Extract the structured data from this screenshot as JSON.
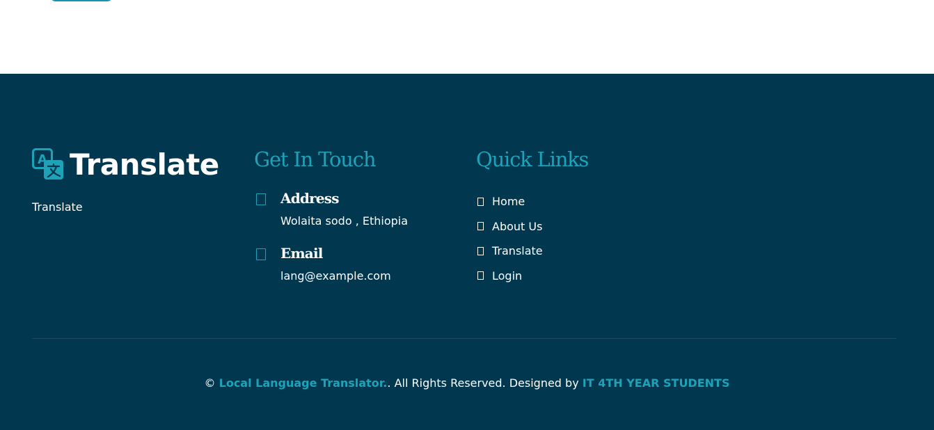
{
  "colors": {
    "footer_background": "#01374f",
    "accent": "#1ea2b8",
    "text": "#ffffff"
  },
  "brand": {
    "name": "Translate",
    "description": "Translate",
    "icon": "translate-icon"
  },
  "contact": {
    "heading": "Get In Touch",
    "address": {
      "icon": "location-icon",
      "title": "Address",
      "value": "Wolaita sodo , Ethiopia"
    },
    "email": {
      "icon": "email-icon",
      "title": "Email",
      "value": "lang@example.com"
    }
  },
  "quick_links": {
    "heading": "Quick Links",
    "bullet_icon": "chevron-right-icon",
    "items": [
      {
        "label": "Home"
      },
      {
        "label": "About Us"
      },
      {
        "label": "Translate"
      },
      {
        "label": "Login"
      }
    ]
  },
  "copyright": {
    "symbol": "©",
    "site_name": "Local Language Translator.",
    "rights_text": ". All Rights Reserved. Designed by",
    "designer": "IT 4TH YEAR STUDENTS"
  }
}
